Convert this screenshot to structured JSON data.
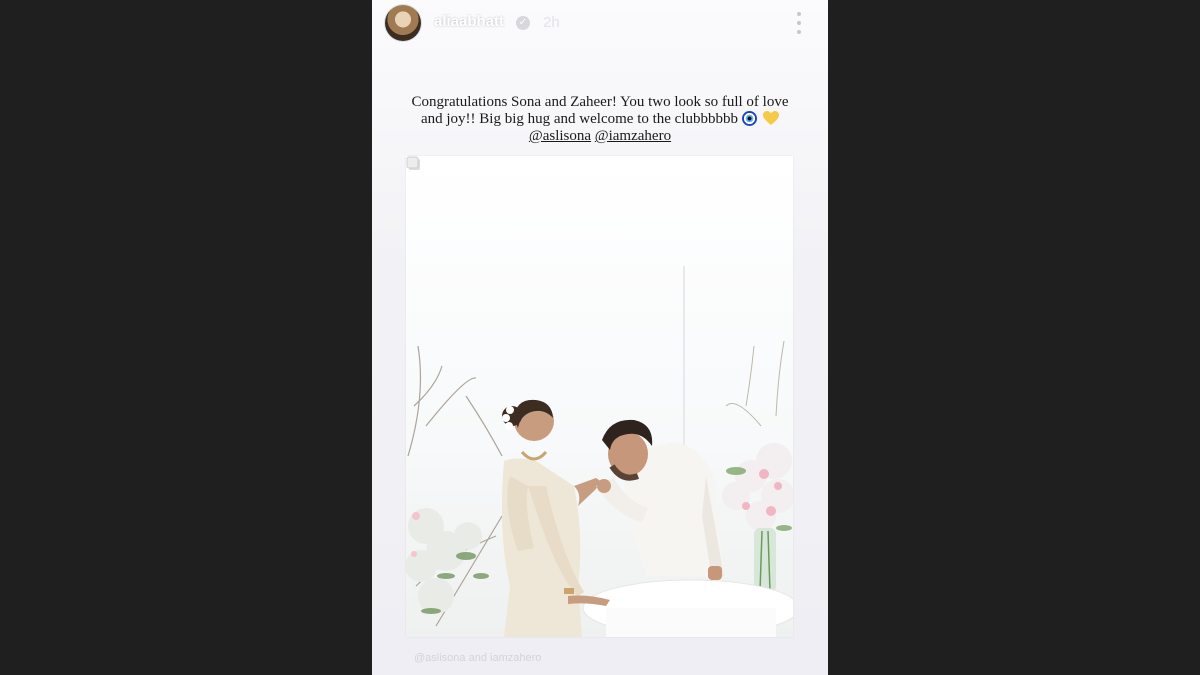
{
  "story": {
    "username": "aliaabhatt",
    "time": "2h",
    "caption_lines": [
      "Congratulations Sona and Zaheer! You two look so full of love",
      "and joy!! Big big hug and welcome to the clubbbbbb"
    ],
    "mentions": [
      "@aslisona",
      "@iamzahero"
    ],
    "tag_mention_1": "@aslisona",
    "tag_and": "and",
    "tag_mention_2": "iamzahero"
  },
  "icons": {
    "verified": "verified-badge-icon",
    "more": "more-options-icon",
    "evil_eye": "nazar-amulet-emoji",
    "heart": "yellow-heart-emoji",
    "copy": "copy-icon"
  },
  "colors": {
    "page_background": "#1f1f1f",
    "story_background": "#f2f2f6"
  }
}
